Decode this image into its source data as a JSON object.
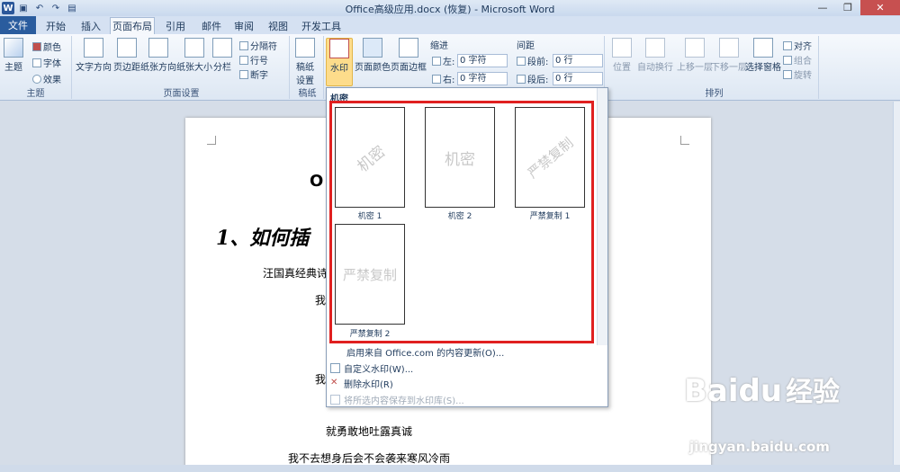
{
  "window": {
    "title": "Office高级应用.docx (恢复) - Microsoft Word"
  },
  "qat": {
    "icons": [
      "word-logo",
      "save-icon",
      "undo-icon",
      "redo-icon",
      "open-icon"
    ]
  },
  "tabs": [
    {
      "label": "文件"
    },
    {
      "label": "开始"
    },
    {
      "label": "插入"
    },
    {
      "label": "页面布局"
    },
    {
      "label": "引用"
    },
    {
      "label": "邮件"
    },
    {
      "label": "审阅"
    },
    {
      "label": "视图"
    },
    {
      "label": "开发工具"
    }
  ],
  "ribbon": {
    "theme": {
      "themes": "主题",
      "colors": "颜色",
      "fonts": "字体",
      "effects": "效果",
      "group": "主题"
    },
    "page_setup": {
      "text_dir": "文字方向",
      "margins": "页边距",
      "orientation": "纸张方向",
      "size": "纸张大小",
      "columns": "分栏",
      "breaks": "分隔符",
      "line_numbers": "行号",
      "hyphenation": "断字",
      "group": "页面设置"
    },
    "manuscript": {
      "settings": "稿纸\n设置",
      "group": "稿纸"
    },
    "background": {
      "watermark": "水印",
      "page_color": "页面颜色",
      "page_border": "页面边框"
    },
    "paragraph": {
      "indent": "缩进",
      "left_lbl": "左:",
      "left_val": "0 字符",
      "right_lbl": "右:",
      "right_val": "0 字符",
      "spacing": "间距",
      "before_lbl": "段前:",
      "before_val": "0 行",
      "after_lbl": "段后:",
      "after_val": "0 行"
    },
    "arrange": {
      "position": "位置",
      "wrap": "自动换行",
      "forward": "上移一层",
      "backward": "下移一层",
      "selection": "选择窗格",
      "align": "对齐",
      "group_btn": "组合",
      "rotate": "旋转",
      "group": "排列"
    }
  },
  "document": {
    "title_partial": "O",
    "heading": "1、如何插",
    "line1": "汪国真经典诗",
    "line2": "我",
    "line3": "我",
    "line4": "就勇敢地吐露真诚",
    "line5": "我不去想身后会不会袭来寒风冷雨"
  },
  "gallery": {
    "header": "机密",
    "items": [
      {
        "label": "机密 1",
        "watermark": "机密",
        "diagonal": true
      },
      {
        "label": "机密 2",
        "watermark": "机密",
        "diagonal": false
      },
      {
        "label": "严禁复制 1",
        "watermark": "严禁复制",
        "diagonal": true
      },
      {
        "label": "严禁复制 2",
        "watermark": "严禁复制",
        "diagonal": false
      }
    ],
    "menu": [
      {
        "label": "启用来自 Office.com 的内容更新(O)...",
        "enabled": true
      },
      {
        "label": "自定义水印(W)...",
        "enabled": true
      },
      {
        "label": "删除水印(R)",
        "enabled": true
      },
      {
        "label": "将所选内容保存到水印库(S)...",
        "enabled": false
      }
    ]
  },
  "watermark_overlay": {
    "brand": "Baidu",
    "jingyan": "经验",
    "url": "jingyan.baidu.com"
  },
  "colors": {
    "accent": "#2a5c9e",
    "highlight": "#fddc8b",
    "red_frame": "#e02020"
  }
}
